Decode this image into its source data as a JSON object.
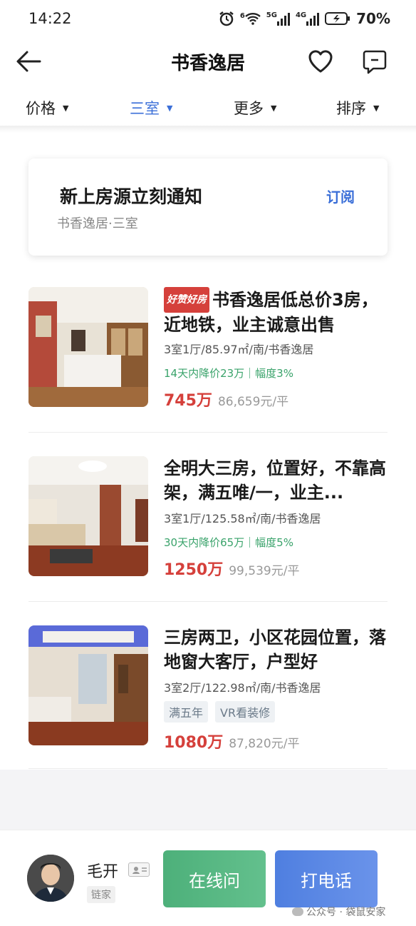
{
  "status_bar": {
    "time": "14:22",
    "network_1": "5G",
    "network_2": "4G",
    "wifi_tag": "6",
    "battery": "70%"
  },
  "nav": {
    "title": "书香逸居"
  },
  "filters": [
    {
      "label": "价格",
      "active": false
    },
    {
      "label": "三室",
      "active": true
    },
    {
      "label": "更多",
      "active": false
    },
    {
      "label": "排序",
      "active": false
    }
  ],
  "subscribe": {
    "title": "新上房源立刻通知",
    "desc": "书香逸居·三室",
    "button": "订阅"
  },
  "listings": [
    {
      "badge": "好赞好房",
      "title": "书香逸居低总价3房，近地铁，业主诚意出售",
      "specs": "3室1厅/85.97㎡/南/书香逸居",
      "price_drop": "14天内降价23万｜幅度3%",
      "price": "745万",
      "unit_price": "86,659元/平"
    },
    {
      "title": "全明大三房，位置好，不靠高架，满五唯/一，业主...",
      "specs": "3室1厅/125.58㎡/南/书香逸居",
      "price_drop": "30天内降价65万｜幅度5%",
      "price": "1250万",
      "unit_price": "99,539元/平"
    },
    {
      "title": "三房两卫，小区花园位置，落地窗大客厅，户型好",
      "specs": "3室2厅/122.98㎡/南/书香逸居",
      "tags": [
        "满五年",
        "VR看装修"
      ],
      "price": "1080万",
      "unit_price": "87,820元/平"
    }
  ],
  "agent": {
    "name": "毛开",
    "brand": "链家",
    "chat_button": "在线问",
    "call_button": "打电话"
  },
  "watermark": "公众号 · 袋鼠安家",
  "colors": {
    "accent_blue": "#3b6fd8",
    "price_red": "#d5403b",
    "drop_green": "#3aa36b",
    "chat_green": "#4db07a",
    "call_blue": "#4f7fe0"
  }
}
